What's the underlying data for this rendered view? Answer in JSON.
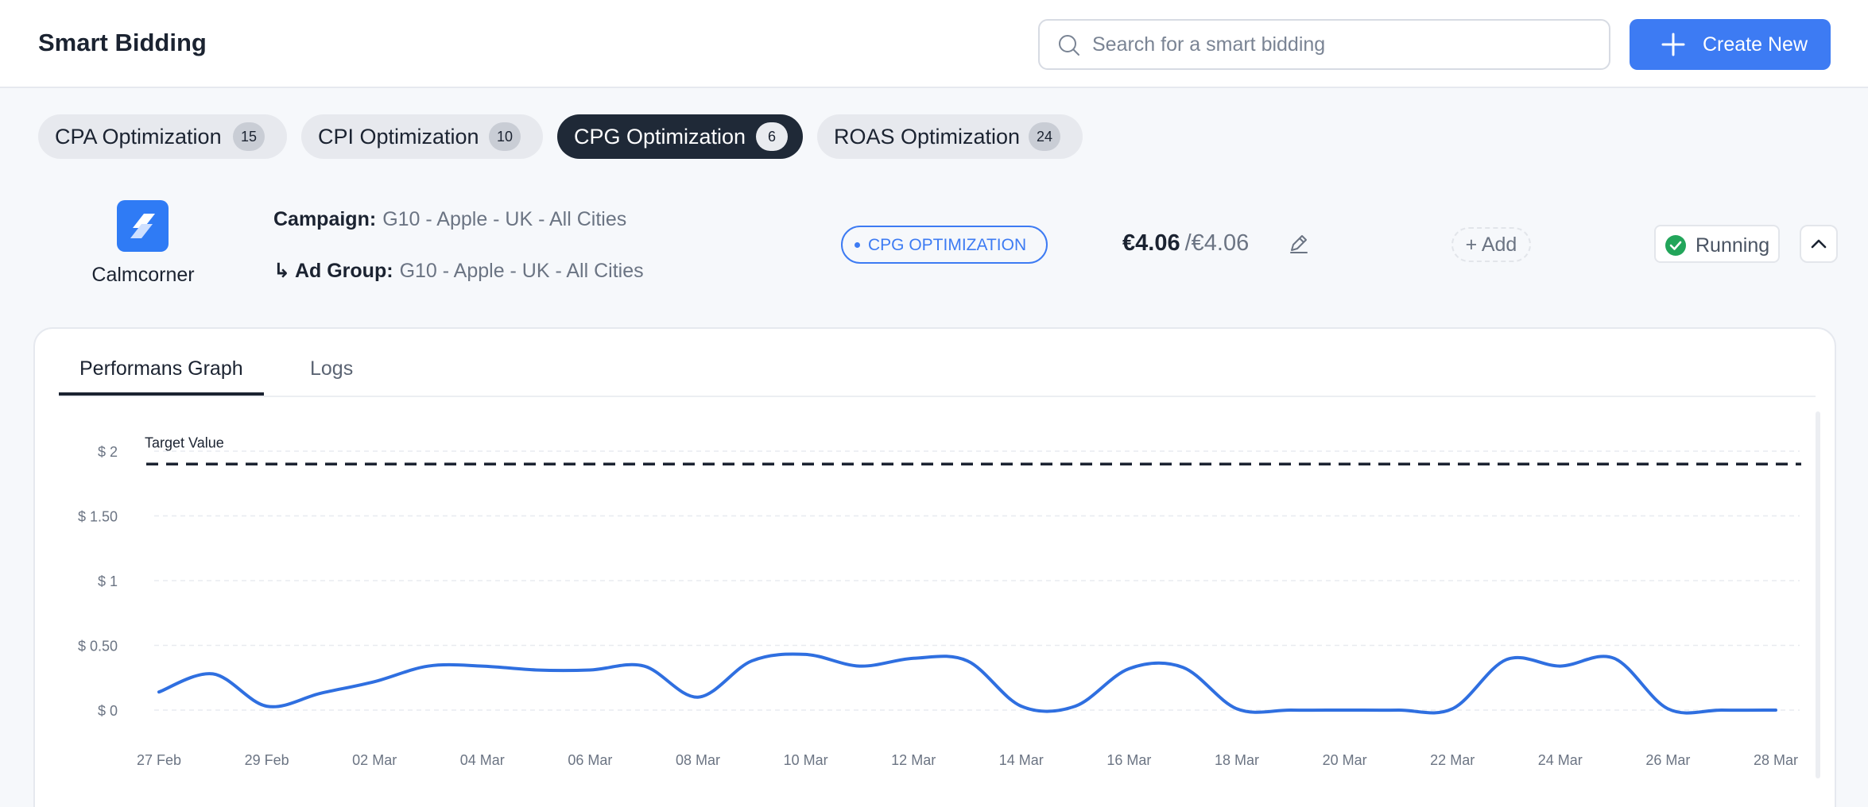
{
  "header": {
    "title": "Smart Bidding",
    "search_placeholder": "Search for a smart bidding",
    "create_label": "Create New"
  },
  "tabs": [
    {
      "label": "CPA Optimization",
      "count": "15"
    },
    {
      "label": "CPI Optimization",
      "count": "10"
    },
    {
      "label": "CPG Optimization",
      "count": "6"
    },
    {
      "label": "ROAS Optimization",
      "count": "24"
    }
  ],
  "active_tab": 2,
  "campaign_row": {
    "brand": "Calmcorner",
    "campaign_key": "Campaign:",
    "campaign_value": "G10 - Apple - UK - All Cities",
    "adgroup_key": "↳ Ad Group:",
    "adgroup_value": "G10 - Apple - UK - All Cities",
    "badge": "CPG OPTIMIZATION",
    "price_current": "€4.06",
    "price_total": "/€4.06",
    "add_label": "+ Add",
    "status": "Running"
  },
  "card": {
    "tabs": [
      "Performans Graph",
      "Logs"
    ],
    "active": 0
  },
  "colors": {
    "accent": "#3d7bf3",
    "dark": "#1f2937",
    "success": "#22a55a",
    "line": "#2f6fe0"
  },
  "chart_data": {
    "type": "line",
    "x": [
      "27 Feb",
      "28 Feb",
      "29 Feb",
      "01 Mar",
      "02 Mar",
      "03 Mar",
      "04 Mar",
      "05 Mar",
      "06 Mar",
      "07 Mar",
      "08 Mar",
      "09 Mar",
      "10 Mar",
      "11 Mar",
      "12 Mar",
      "13 Mar",
      "14 Mar",
      "15 Mar",
      "16 Mar",
      "17 Mar",
      "18 Mar",
      "19 Mar",
      "20 Mar",
      "21 Mar",
      "22 Mar",
      "23 Mar",
      "24 Mar",
      "25 Mar",
      "26 Mar",
      "27 Mar",
      "28 Mar"
    ],
    "xticks": [
      "27 Feb",
      "29 Feb",
      "02 Mar",
      "04 Mar",
      "06 Mar",
      "08 Mar",
      "10 Mar",
      "12 Mar",
      "14 Mar",
      "16 Mar",
      "18 Mar",
      "20 Mar",
      "22 Mar",
      "24 Mar",
      "26 Mar",
      "28 Mar"
    ],
    "series": [
      {
        "values": [
          0.14,
          0.28,
          0.03,
          0.13,
          0.22,
          0.34,
          0.34,
          0.31,
          0.31,
          0.34,
          0.1,
          0.38,
          0.43,
          0.34,
          0.4,
          0.38,
          0.03,
          0.03,
          0.32,
          0.33,
          0.01,
          0.0,
          0.0,
          0.0,
          0.01,
          0.39,
          0.34,
          0.4,
          0.01,
          0.0,
          0.0
        ]
      }
    ],
    "yticks": [
      "$ 0",
      "$ 0.50",
      "$ 1",
      "$ 1.50",
      "$ 2"
    ],
    "ytick_values": [
      0,
      0.5,
      1,
      1.5,
      2
    ],
    "ylim": [
      0,
      2
    ],
    "target_label": "Target Value",
    "target_value": 1.9,
    "grid": true
  }
}
